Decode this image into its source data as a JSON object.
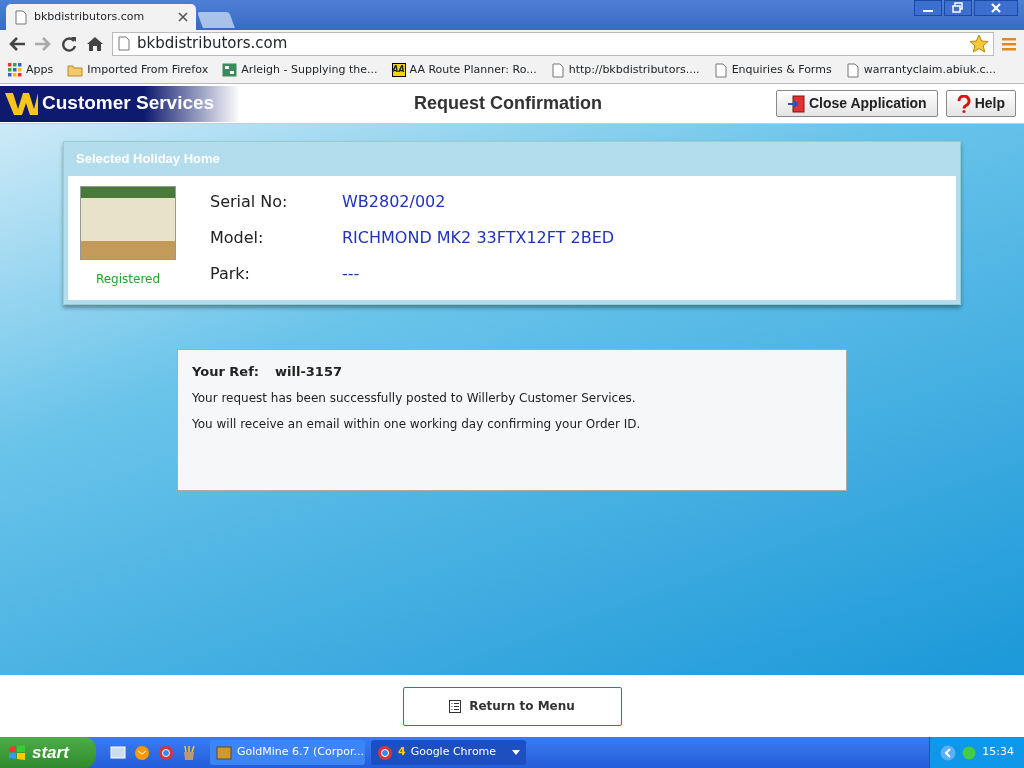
{
  "browser": {
    "tabs": [
      {
        "title": "bkbdistributors.com",
        "selected": true
      }
    ],
    "address": "bkbdistributors.com",
    "bookmarks": [
      {
        "label": "Apps",
        "kind": "apps"
      },
      {
        "label": "Imported From Firefox",
        "kind": "folder"
      },
      {
        "label": "Arleigh - Supplying the...",
        "kind": "sheet"
      },
      {
        "label": "AA Route Planner: Ro...",
        "kind": "logo",
        "logo_text": "AA"
      },
      {
        "label": "http://bkbdistributors....",
        "kind": "page"
      },
      {
        "label": "Enquiries & Forms",
        "kind": "page"
      },
      {
        "label": "warrantyclaim.abiuk.c...",
        "kind": "page"
      }
    ]
  },
  "app": {
    "brand": "Customer Services",
    "page_title": "Request Confirmation",
    "header_buttons": [
      {
        "label": "Close Application",
        "kind": "exit"
      },
      {
        "label": "Help",
        "kind": "help"
      }
    ]
  },
  "holiday_home": {
    "title": "Selected Holiday Home",
    "status": "Registered",
    "fields": [
      {
        "label": "Serial No:",
        "value": "WB2802/002"
      },
      {
        "label": "Model:",
        "value": "RICHMOND MK2 33FTX12FT 2BED"
      },
      {
        "label": "Park:",
        "value": "---"
      }
    ]
  },
  "confirmation": {
    "ref_label": "Your Ref:",
    "ref_value": "will-3157",
    "messages": [
      "Your request has been successfully posted to Willerby Customer Services.",
      "You will receive an email within one working day confirming your Order ID."
    ]
  },
  "footer": {
    "button": "Return to Menu"
  },
  "taskbar": {
    "start": "start",
    "tasks": [
      {
        "label": "GoldMine 6.7 (Corpor...",
        "selected": false
      },
      {
        "label": "Google Chrome",
        "count": "4",
        "selected": true
      }
    ],
    "clock": "15:34"
  }
}
